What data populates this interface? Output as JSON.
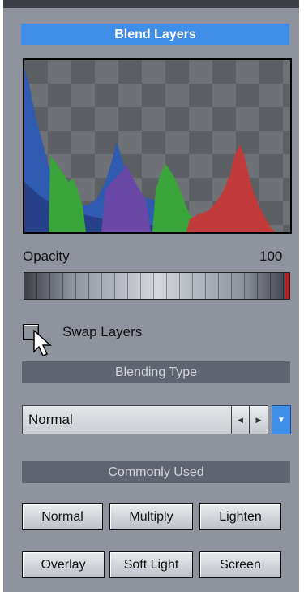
{
  "panel": {
    "title": "Blend Layers"
  },
  "opacity": {
    "label": "Opacity",
    "value": "100",
    "fraction": 1.0
  },
  "swap_layers": {
    "label": "Swap Layers",
    "checked": false
  },
  "blending_type": {
    "header": "Blending Type",
    "selected": "Normal"
  },
  "commonly_used": {
    "header": "Commonly Used",
    "buttons": [
      "Normal",
      "Multiply",
      "Lighten",
      "Overlay",
      "Soft Light",
      "Screen"
    ]
  },
  "icons": {
    "cursor": "mouse-pointer-icon",
    "prev": "arrow-left-icon",
    "next": "arrow-right-icon",
    "dropdown": "chevron-down-icon"
  },
  "colors": {
    "accent": "#3f8ee8",
    "panel_bg": "#8e939e",
    "header_bg": "#5f6470",
    "histogram_red": "#c23b3b",
    "histogram_green": "#3aa53a",
    "histogram_blue": "#2f5bb0",
    "histogram_purple": "#6a48a8",
    "histogram_navy": "#26408a"
  }
}
